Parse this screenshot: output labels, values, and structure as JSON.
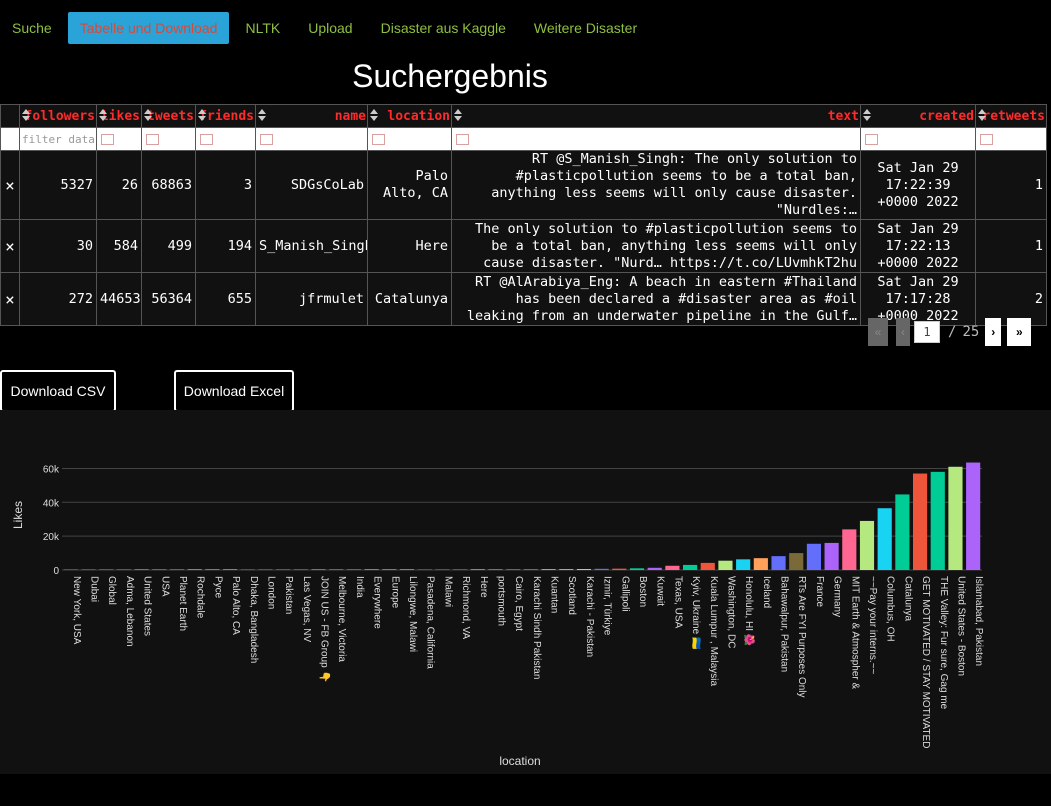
{
  "nav": {
    "tabs": [
      {
        "label": "Suche",
        "active": false
      },
      {
        "label": "Tabelle und Download",
        "active": true
      },
      {
        "label": "NLTK",
        "active": false
      },
      {
        "label": "Upload",
        "active": false
      },
      {
        "label": "Disaster aus Kaggle",
        "active": false
      },
      {
        "label": "Weitere Disaster",
        "active": false
      }
    ]
  },
  "page_title": "Suchergebnis",
  "table": {
    "columns": [
      "followers",
      "likes",
      "tweets",
      "friends",
      "name",
      "location",
      "text",
      "created",
      "retweets"
    ],
    "filter_placeholder": "filter data...",
    "delete_glyph": "×",
    "rows": [
      {
        "followers": "5327",
        "likes": "26",
        "tweets": "68863",
        "friends": "3",
        "name": "SDGsCoLab",
        "location": "Palo Alto, CA",
        "text": "RT @S_Manish_Singh: The only solution to #plasticpollution seems to be a total ban, anything less seems will only cause disaster. \"Nurdles:…",
        "created": "Sat Jan 29 17:22:39 +0000 2022",
        "retweets": "1"
      },
      {
        "followers": "30",
        "likes": "584",
        "tweets": "499",
        "friends": "194",
        "name": "S_Manish_Singh",
        "location": "Here",
        "text": "The only solution to #plasticpollution seems to be a total ban, anything less seems will only cause disaster. \"Nurd… https://t.co/LUvmhkT2hu",
        "created": "Sat Jan 29 17:22:13 +0000 2022",
        "retweets": "1"
      },
      {
        "followers": "272",
        "likes": "44653",
        "tweets": "56364",
        "friends": "655",
        "name": "jfrmulet",
        "location": "Catalunya",
        "text": "RT @AlArabiya_Eng: A beach in eastern #Thailand has been declared a #disaster area as #oil leaking from an underwater pipeline in the Gulf…",
        "created": "Sat Jan 29 17:17:28 +0000 2022",
        "retweets": "2"
      }
    ]
  },
  "pagination": {
    "first": "«",
    "prev": "‹",
    "current": "1",
    "separator": "/",
    "total": "25",
    "next": "›",
    "last": "»"
  },
  "buttons": {
    "download_csv": "Download CSV",
    "download_excel": "Download Excel"
  },
  "chart_data": {
    "type": "bar",
    "xlabel": "location",
    "ylabel": "Likes",
    "ylim": [
      0,
      65000
    ],
    "yticks": [
      0,
      20000,
      40000,
      60000
    ],
    "ytick_labels": [
      "0",
      "20k",
      "40k",
      "60k"
    ],
    "grid": true,
    "legend": "none",
    "categories": [
      "New York, USA",
      "Dubai",
      "Global",
      "Adma, Lebanon",
      "United States",
      "USA",
      "Planet Earth",
      "Rochdale",
      "Pyce",
      "Palo Alto, CA",
      "Dhaka, Bangladesh",
      "London",
      "Pakistan",
      "Las Vegas, NV",
      "JOIN US - FB Group 👇",
      "Melbourne, Victoria",
      "India",
      "Everywhere",
      "Europe",
      "Lilongwe, Malawi",
      "Pasadena, California",
      "Malawi",
      "Richmond, VA",
      "Here",
      "portsmouth",
      "Cairo, Egypt",
      "Karachi Sindh Pakistan",
      "Kuantan",
      "Scotland",
      "Karachi - Pakistan",
      "Izmir, Türkiye",
      "Gallipoli",
      "Boston",
      "Kuwait",
      "Texas, USA",
      "Kyiv, Ukraine 🇺🇦",
      "Kuala Lumpur , Malaysia",
      "Washington, DC",
      "Honolulu, HI 🌺",
      "Iceland",
      "Bahawalpur, Pakistan",
      "RTs Are FYI Purposes Only",
      "France",
      "Germany",
      "MIT Earth & Atmospher &",
      "~~Pay your interns.~~",
      "Columbus, OH",
      "Catalunya",
      "GET MOTIVATED / STAY MOTIVATED",
      "THE Valley: Fur sure, Gag me",
      "United States - Boston",
      "Islamabad, Pakistan"
    ],
    "values": [
      5,
      10,
      15,
      20,
      26,
      30,
      40,
      50,
      60,
      70,
      80,
      90,
      100,
      110,
      120,
      130,
      140,
      150,
      160,
      180,
      200,
      230,
      260,
      584,
      300,
      350,
      400,
      450,
      500,
      550,
      700,
      800,
      1000,
      1300,
      2500,
      3000,
      4200,
      5500,
      6300,
      7000,
      8200,
      10000,
      15500,
      16000,
      24000,
      29000,
      36500,
      44653,
      57000,
      58000,
      61000,
      63500
    ],
    "colors": [
      "#636efa",
      "#ef553b",
      "#00cc96",
      "#ab63fa",
      "#ffa15a",
      "#19d3f3",
      "#ff6692",
      "#b6e880",
      "#ff97ff",
      "#fecb52",
      "#636efa",
      "#ef553b",
      "#00cc96",
      "#ab63fa",
      "#ffa15a",
      "#19d3f3",
      "#ff6692",
      "#b6e880",
      "#ff97ff",
      "#fecb52",
      "#636efa",
      "#ef553b",
      "#00cc96",
      "#ab63fa",
      "#ffa15a",
      "#19d3f3",
      "#ff6692",
      "#b6e880",
      "#ff97ff",
      "#fecb52",
      "#636efa",
      "#ef553b",
      "#00cc96",
      "#ab63fa",
      "#ff6692",
      "#00cc96",
      "#ef553b",
      "#b6e880",
      "#19d3f3",
      "#ffa15a",
      "#636efa",
      "#7a6a3a",
      "#636efa",
      "#ab63fa",
      "#ff6692",
      "#b6e880",
      "#19d3f3",
      "#00cc96",
      "#ef553b",
      "#00cc96",
      "#b6e880",
      "#ab63fa"
    ]
  }
}
